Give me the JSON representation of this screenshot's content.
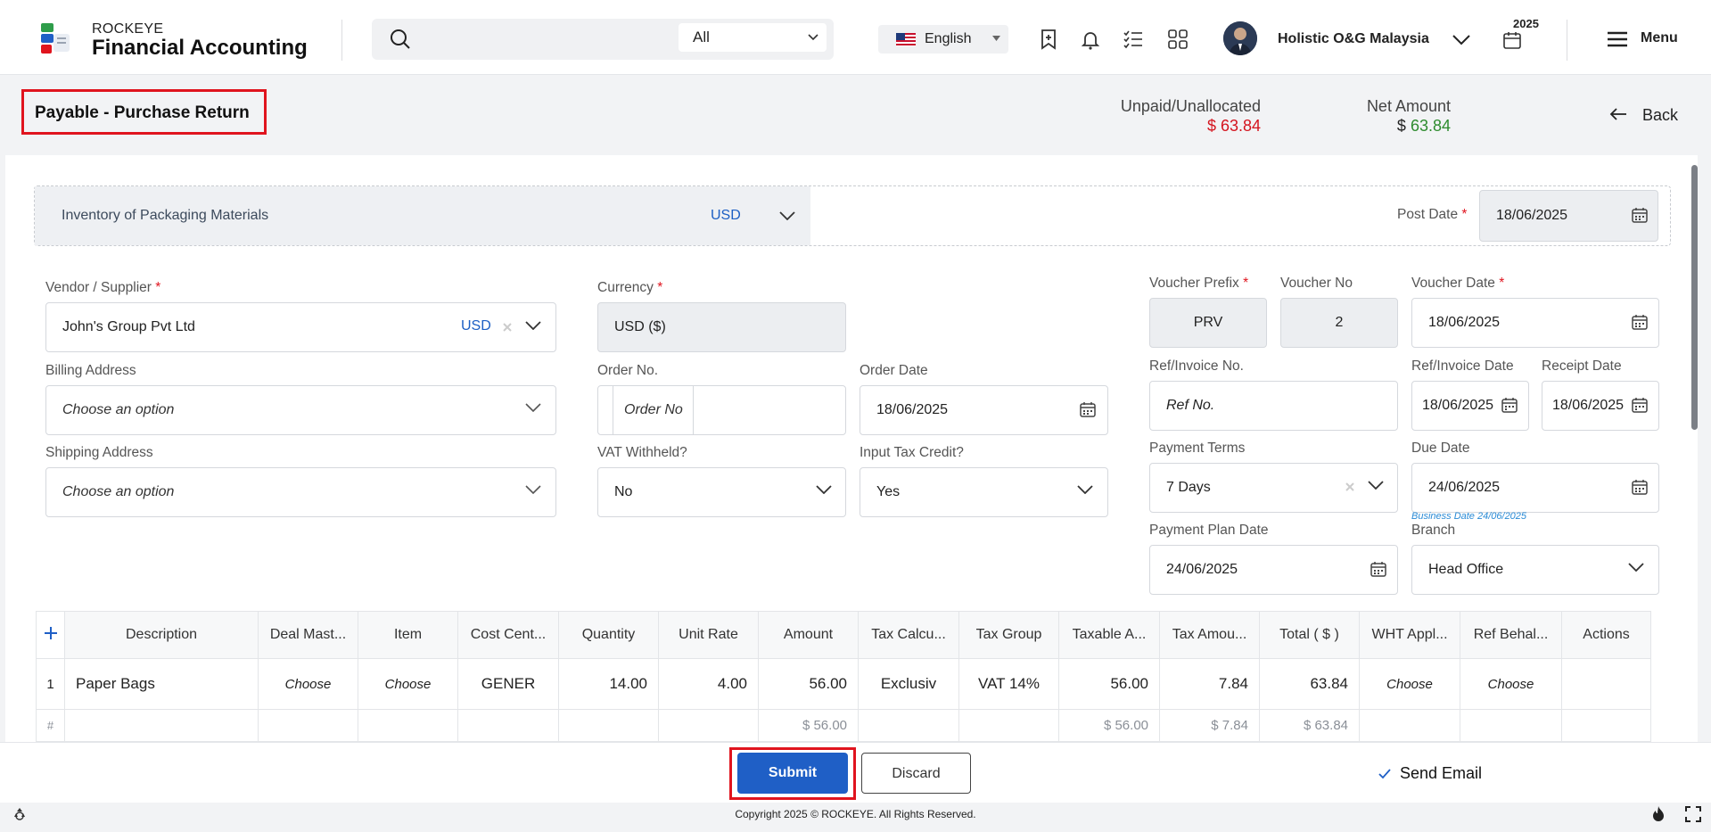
{
  "app": {
    "brand_small": "ROCKEYE",
    "brand_big": "Financial Accounting"
  },
  "search": {
    "scope": "All"
  },
  "language": {
    "label": "English"
  },
  "user": {
    "company": "Holistic O&G Malaysia",
    "year": "2025"
  },
  "menu_label": "Menu",
  "page": {
    "title": "Payable - Purchase Return",
    "unpaid_label": "Unpaid/Unallocated",
    "unpaid_value": "$ 63.84",
    "net_label": "Net Amount",
    "net_currency": "$",
    "net_value": "63.84",
    "back_label": "Back"
  },
  "account": {
    "name": "Inventory of Packaging Materials",
    "currency": "USD"
  },
  "post_date": {
    "label": "Post Date",
    "value": "18/06/2025"
  },
  "form": {
    "vendor_label": "Vendor / Supplier",
    "vendor_value": "John's Group Pvt Ltd",
    "vendor_currency": "USD",
    "currency_label": "Currency",
    "currency_value": "USD ($)",
    "billing_label": "Billing Address",
    "billing_placeholder": "Choose an option",
    "order_no_label": "Order No.",
    "order_no_placeholder": "Order No",
    "order_date_label": "Order Date",
    "order_date_value": "18/06/2025",
    "shipping_label": "Shipping Address",
    "shipping_placeholder": "Choose an option",
    "vat_label": "VAT Withheld?",
    "vat_value": "No",
    "itc_label": "Input Tax Credit?",
    "itc_value": "Yes",
    "voucher_prefix_label": "Voucher Prefix",
    "voucher_prefix_value": "PRV",
    "voucher_no_label": "Voucher No",
    "voucher_no_value": "2",
    "voucher_date_label": "Voucher Date",
    "voucher_date_value": "18/06/2025",
    "ref_label": "Ref/Invoice No.",
    "ref_placeholder": "Ref No.",
    "ref_date_label": "Ref/Invoice Date",
    "ref_date_value": "18/06/2025",
    "receipt_date_label": "Receipt Date",
    "receipt_date_value": "18/06/2025",
    "payment_terms_label": "Payment Terms",
    "payment_terms_value": "7 Days",
    "due_date_label": "Due Date",
    "due_date_value": "24/06/2025",
    "business_date_note": "Business Date 24/06/2025",
    "payment_plan_label": "Payment Plan Date",
    "payment_plan_value": "24/06/2025",
    "branch_label": "Branch",
    "branch_value": "Head Office"
  },
  "table": {
    "headers": [
      "Description",
      "Deal Mast...",
      "Item",
      "Cost Cent...",
      "Quantity",
      "Unit Rate",
      "Amount",
      "Tax Calcu...",
      "Tax Group",
      "Taxable A...",
      "Tax Amou...",
      "Total ( $ )",
      "WHT Appl...",
      "Ref Behal...",
      "Actions"
    ],
    "row": {
      "index": "1",
      "description": "Paper Bags",
      "deal_master": "Choose",
      "item": "Choose",
      "cost_center": "GENER",
      "quantity": "14.00",
      "unit_rate": "4.00",
      "amount": "56.00",
      "tax_calc": "Exclusiv",
      "tax_group": "VAT 14%",
      "taxable_amount": "56.00",
      "tax_amount": "7.84",
      "total": "63.84",
      "wht": "Choose",
      "ref_behalf": "Choose"
    },
    "footer": {
      "hash": "#",
      "amount": "$ 56.00",
      "taxable": "$ 56.00",
      "tax": "$ 7.84",
      "total": "$ 63.84"
    }
  },
  "actions": {
    "submit": "Submit",
    "discard": "Discard",
    "send_email": "Send Email"
  },
  "footer": {
    "copyright": "Copyright 2025 © ROCKEYE. All Rights Reserved."
  },
  "colors": {
    "accent": "#1f5fc6",
    "highlight": "#e0141e",
    "unpaid": "#d4141e",
    "net": "#2e8b2e"
  }
}
